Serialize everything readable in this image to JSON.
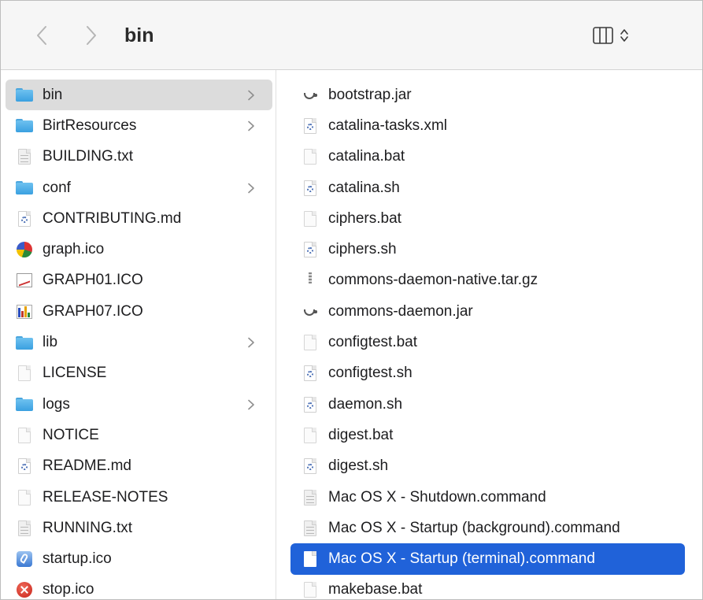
{
  "window": {
    "title": "bin"
  },
  "column1": {
    "items": [
      {
        "label": "bin",
        "icon": "folder-icon",
        "folder": true,
        "selected": true
      },
      {
        "label": "BirtResources",
        "icon": "folder-icon",
        "folder": true
      },
      {
        "label": "BUILDING.txt",
        "icon": "text-document-icon"
      },
      {
        "label": "conf",
        "icon": "folder-icon",
        "folder": true
      },
      {
        "label": "CONTRIBUTING.md",
        "icon": "script-document-icon"
      },
      {
        "label": "graph.ico",
        "icon": "pie-chart-icon"
      },
      {
        "label": "GRAPH01.ICO",
        "icon": "line-chart-icon"
      },
      {
        "label": "GRAPH07.ICO",
        "icon": "bar-chart-icon"
      },
      {
        "label": "lib",
        "icon": "folder-icon",
        "folder": true
      },
      {
        "label": "LICENSE",
        "icon": "blank-document-icon"
      },
      {
        "label": "logs",
        "icon": "folder-icon",
        "folder": true
      },
      {
        "label": "NOTICE",
        "icon": "blank-document-icon"
      },
      {
        "label": "README.md",
        "icon": "script-document-icon"
      },
      {
        "label": "RELEASE-NOTES",
        "icon": "blank-document-icon"
      },
      {
        "label": "RUNNING.txt",
        "icon": "text-document-icon"
      },
      {
        "label": "startup.ico",
        "icon": "startup-app-icon"
      },
      {
        "label": "stop.ico",
        "icon": "stop-icon"
      }
    ]
  },
  "column2": {
    "items": [
      {
        "label": "bootstrap.jar",
        "icon": "jar-icon"
      },
      {
        "label": "catalina-tasks.xml",
        "icon": "script-document-icon"
      },
      {
        "label": "catalina.bat",
        "icon": "blank-document-icon"
      },
      {
        "label": "catalina.sh",
        "icon": "script-document-icon"
      },
      {
        "label": "ciphers.bat",
        "icon": "blank-document-icon"
      },
      {
        "label": "ciphers.sh",
        "icon": "script-document-icon"
      },
      {
        "label": "commons-daemon-native.tar.gz",
        "icon": "archive-icon"
      },
      {
        "label": "commons-daemon.jar",
        "icon": "jar-icon"
      },
      {
        "label": "configtest.bat",
        "icon": "blank-document-icon"
      },
      {
        "label": "configtest.sh",
        "icon": "script-document-icon"
      },
      {
        "label": "daemon.sh",
        "icon": "script-document-icon"
      },
      {
        "label": "digest.bat",
        "icon": "blank-document-icon"
      },
      {
        "label": "digest.sh",
        "icon": "script-document-icon"
      },
      {
        "label": "Mac OS X - Shutdown.command",
        "icon": "command-document-icon"
      },
      {
        "label": "Mac OS X - Startup (background).command",
        "icon": "command-document-icon"
      },
      {
        "label": "Mac OS X - Startup (terminal).command",
        "icon": "command-document-icon",
        "selected": true
      },
      {
        "label": "makebase.bat",
        "icon": "blank-document-icon"
      }
    ]
  },
  "colors": {
    "selection_blue": "#2062d9",
    "selection_gray": "#dcdcdc",
    "folder_blue": "#4aa5dd"
  }
}
